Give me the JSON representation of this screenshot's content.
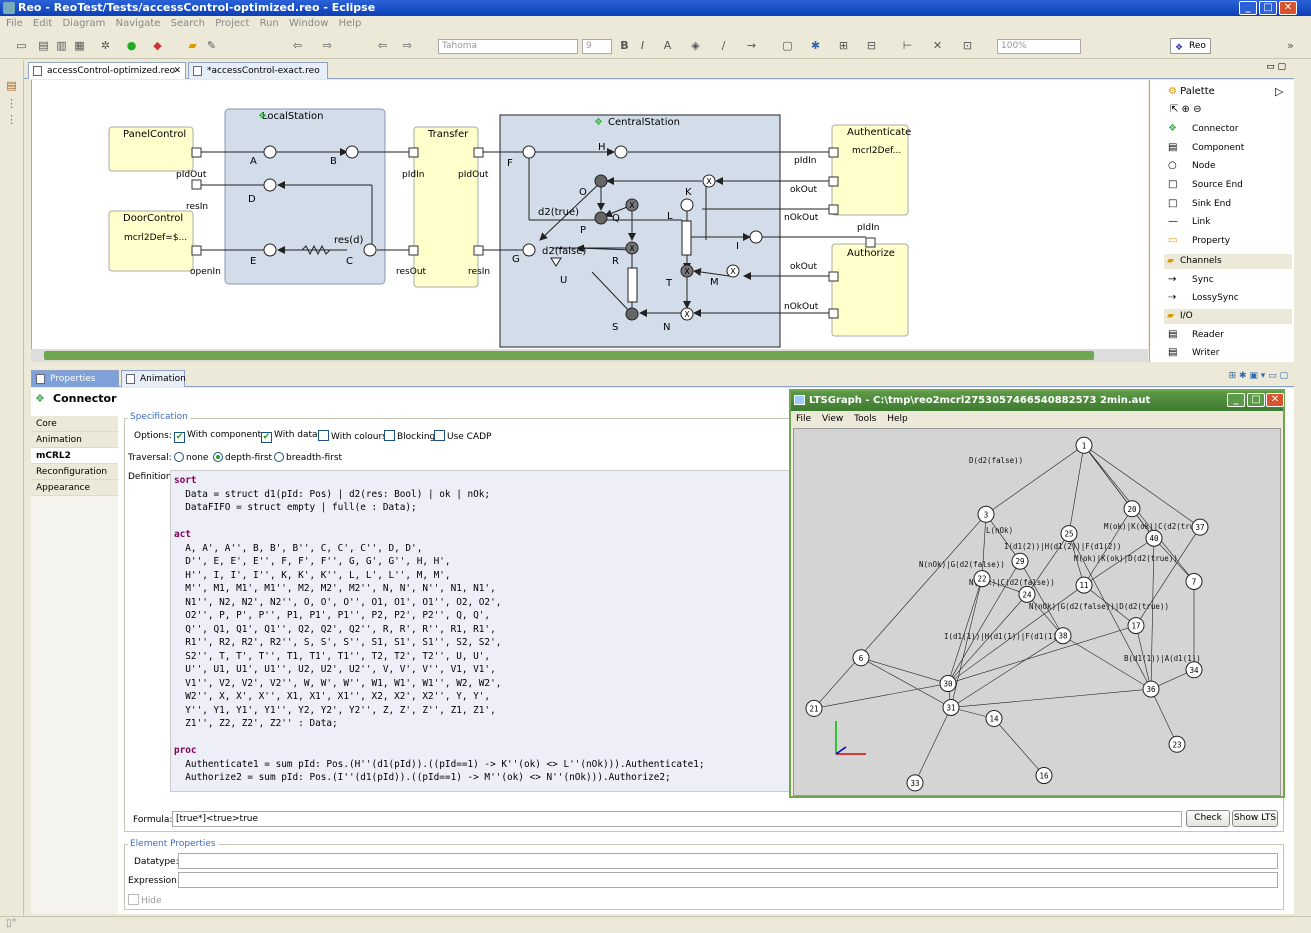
{
  "window": {
    "title": "Reo - ReoTest/Tests/accessControl-optimized.reo - Eclipse"
  },
  "menu": [
    "File",
    "Edit",
    "Diagram",
    "Navigate",
    "Search",
    "Project",
    "Run",
    "Window",
    "Help"
  ],
  "toolbar": {
    "font": "Tahoma",
    "font_size": "9",
    "zoom": "100%",
    "perspective": "Reo"
  },
  "editor_tabs": [
    {
      "label": "accessControl-optimized.reo",
      "active": true
    },
    {
      "label": "*accessControl-exact.reo",
      "active": false
    }
  ],
  "diagram": {
    "components": {
      "panel_control": {
        "name": "PanelControl",
        "port_out": "pIdOut",
        "port_in": "resIn"
      },
      "door_control": {
        "name": "DoorControl",
        "property": "mcrl2Def=$...",
        "port": "openIn"
      },
      "local_station": {
        "name": "LocalStation"
      },
      "transfer": {
        "name": "Transfer",
        "ports": [
          "pIdIn",
          "pIdOut",
          "resOut",
          "resIn"
        ]
      },
      "central_station": {
        "name": "CentralStation"
      },
      "authenticate": {
        "name": "Authenticate",
        "property": "mcrl2Def...",
        "ports": [
          "pIdIn",
          "okOut",
          "nOkOut"
        ]
      },
      "authorize": {
        "name": "Authorize",
        "ports": [
          "pIdIn",
          "okOut",
          "nOkOut"
        ]
      }
    },
    "local_nodes": [
      "A",
      "B",
      "D",
      "E",
      "C",
      "res(d)"
    ],
    "central_nodes": [
      "F",
      "H",
      "O",
      "K",
      "d2(true)",
      "Q",
      "L",
      "P",
      "I",
      "G",
      "d2(false)",
      "R",
      "U",
      "T",
      "M",
      "S",
      "N"
    ]
  },
  "palette": {
    "title": "Palette",
    "items": [
      "Connector",
      "Component",
      "Node",
      "Source End",
      "Sink End",
      "Link",
      "Property"
    ],
    "channels_label": "Channels",
    "channels": [
      "Sync",
      "LossySync"
    ],
    "io_label": "I/O",
    "io": [
      "Reader",
      "Writer"
    ]
  },
  "bottom_tabs": [
    "Properties",
    "Animation"
  ],
  "properties": {
    "header": "Connector",
    "tabs": [
      "Core",
      "Animation",
      "mCRL2",
      "Reconfiguration",
      "Appearance"
    ],
    "active_tab": "mCRL2",
    "specification_label": "Specification",
    "options_label": "Options:",
    "options": [
      {
        "label": "With components",
        "checked": true
      },
      {
        "label": "With data",
        "checked": true
      },
      {
        "label": "With colours",
        "checked": false
      },
      {
        "label": "Blocking",
        "checked": false
      },
      {
        "label": "Use CADP",
        "checked": false
      }
    ],
    "traversal_label": "Traversal:",
    "traversal": [
      {
        "label": "none",
        "selected": false
      },
      {
        "label": "depth-first",
        "selected": true
      },
      {
        "label": "breadth-first",
        "selected": false
      }
    ],
    "definition_label": "Definition:",
    "definition_lines": [
      {
        "kw": "sort",
        "text": ""
      },
      {
        "kw": "",
        "text": "  Data = struct d1(pId: Pos) | d2(res: Bool) | ok | nOk;"
      },
      {
        "kw": "",
        "text": "  DataFIFO = struct empty | full(e : Data);"
      },
      {
        "kw": "",
        "text": ""
      },
      {
        "kw": "act",
        "text": ""
      },
      {
        "kw": "",
        "text": "  A, A', A'', B, B', B'', C, C', C'', D, D',"
      },
      {
        "kw": "",
        "text": "  D'', E, E', E'', F, F', F'', G, G', G'', H, H',"
      },
      {
        "kw": "",
        "text": "  H'', I, I', I'', K, K', K'', L, L', L'', M, M',"
      },
      {
        "kw": "",
        "text": "  M'', M1, M1', M1'', M2, M2', M2'', N, N', N'', N1, N1',"
      },
      {
        "kw": "",
        "text": "  N1'', N2, N2', N2'', O, O', O'', O1, O1', O1'', O2, O2',"
      },
      {
        "kw": "",
        "text": "  O2'', P, P', P'', P1, P1', P1'', P2, P2', P2'', Q, Q',"
      },
      {
        "kw": "",
        "text": "  Q'', Q1, Q1', Q1'', Q2, Q2', Q2'', R, R', R'', R1, R1',"
      },
      {
        "kw": "",
        "text": "  R1'', R2, R2', R2'', S, S', S'', S1, S1', S1'', S2, S2',"
      },
      {
        "kw": "",
        "text": "  S2'', T, T', T'', T1, T1', T1'', T2, T2', T2'', U, U',"
      },
      {
        "kw": "",
        "text": "  U'', U1, U1', U1'', U2, U2', U2'', V, V', V'', V1, V1',"
      },
      {
        "kw": "",
        "text": "  V1'', V2, V2', V2'', W, W', W'', W1, W1', W1'', W2, W2',"
      },
      {
        "kw": "",
        "text": "  W2'', X, X', X'', X1, X1', X1'', X2, X2', X2'', Y, Y',"
      },
      {
        "kw": "",
        "text": "  Y'', Y1, Y1', Y1'', Y2, Y2', Y2'', Z, Z', Z'', Z1, Z1',"
      },
      {
        "kw": "",
        "text": "  Z1'', Z2, Z2', Z2'' : Data;"
      },
      {
        "kw": "",
        "text": ""
      },
      {
        "kw": "proc",
        "text": ""
      },
      {
        "kw": "",
        "text": "  Authenticate1 = sum pId: Pos.(H''(d1(pId)).((pId==1) -> K''(ok) <> L''(nOk))).Authenticate1;"
      },
      {
        "kw": "",
        "text": "  Authorize2 = sum pId: Pos.(I''(d1(pId)).((pId==1) -> M''(ok) <> N''(nOk))).Authorize2;"
      }
    ],
    "formula_label": "Formula:",
    "formula": "[true*]<true>true",
    "check_button": "Check",
    "show_lts_button": "Show LTS",
    "element_props_label": "Element Properties",
    "datatype_label": "Datatype:",
    "expression_label": "Expression:",
    "hide_label": "Hide"
  },
  "lts": {
    "title": "LTSGraph - C:\\tmp\\reo2mcrl2753057466540882573 2min.aut",
    "menu": [
      "File",
      "View",
      "Tools",
      "Help"
    ],
    "states": [
      "1",
      "3",
      "6",
      "7",
      "11",
      "14",
      "16",
      "17",
      "20",
      "21",
      "22",
      "23",
      "24",
      "25",
      "29",
      "30",
      "31",
      "33",
      "34",
      "36",
      "37",
      "38",
      "40"
    ],
    "transition_labels": [
      "D(d2(false))",
      "L(nOk)",
      "N(nOk)|G(d2(false))",
      "N(nOk)|C(d2(false))",
      "M(ok)|K(ok)|D(d2(true))",
      "I(d1(1))|H(d1(1))|F(d1(1))",
      "B(d1(1))|A(d1(1))",
      "N(nOk)|G(d2(false))|D(d2(true))",
      "M(ok)|K(ok)|C(d2(true))",
      "I(d1(2))|H(d1(2))|F(d1(2))"
    ]
  }
}
